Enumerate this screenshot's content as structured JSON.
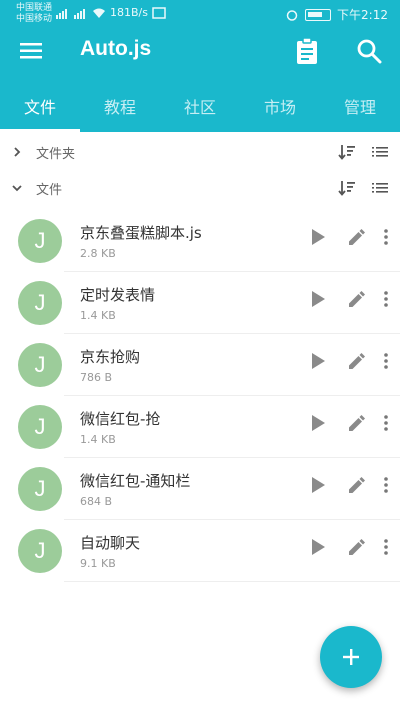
{
  "status_bar": {
    "carrier1": "中国联通",
    "carrier2": "中国移动",
    "speed": "181B/s",
    "time": "下午2:12"
  },
  "toolbar": {
    "title": "Auto.js"
  },
  "tabs": [
    {
      "label": "文件",
      "active": true
    },
    {
      "label": "教程",
      "active": false
    },
    {
      "label": "社区",
      "active": false
    },
    {
      "label": "市场",
      "active": false
    },
    {
      "label": "管理",
      "active": false
    }
  ],
  "sections": {
    "folders": {
      "label": "文件夹",
      "expanded": false
    },
    "files": {
      "label": "文件",
      "expanded": true
    }
  },
  "files": [
    {
      "avatar": "J",
      "name": "京东叠蛋糕脚本.js",
      "size": "2.8 KB"
    },
    {
      "avatar": "J",
      "name": "定时发表情",
      "size": "1.4 KB"
    },
    {
      "avatar": "J",
      "name": "京东抢购",
      "size": "786 B"
    },
    {
      "avatar": "J",
      "name": "微信红包-抢",
      "size": "1.4 KB"
    },
    {
      "avatar": "J",
      "name": "微信红包-通知栏",
      "size": "684 B"
    },
    {
      "avatar": "J",
      "name": "自动聊天",
      "size": "9.1 KB"
    }
  ],
  "colors": {
    "primary": "#1ab8cc",
    "avatar": "#9ccc9a"
  }
}
